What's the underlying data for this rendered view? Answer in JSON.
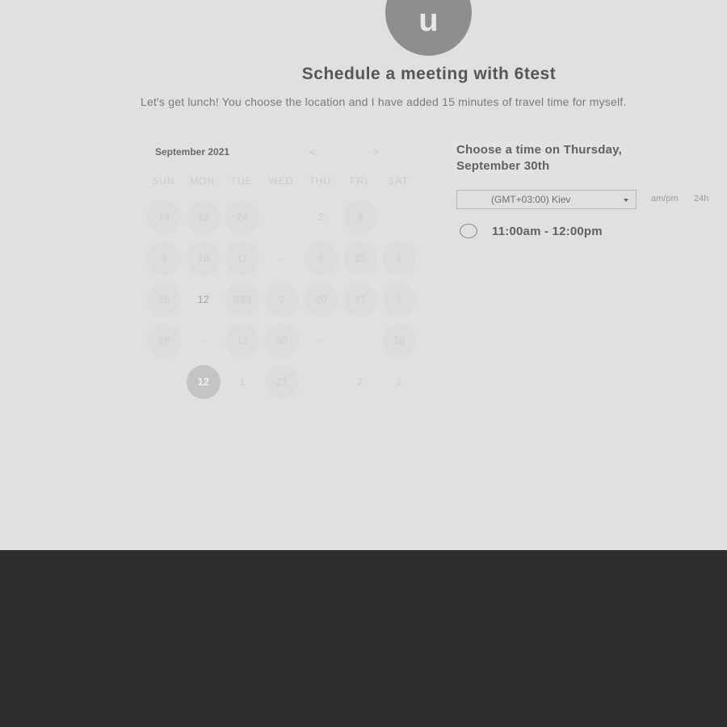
{
  "header": {
    "avatar_letter": "u",
    "title": "Schedule a meeting with 6test",
    "description": "Let's get lunch! You choose the location and I have added 15 minutes of travel time for myself."
  },
  "calendar": {
    "month_label": "September 2021",
    "prev_icon": "<",
    "next_icon": ">",
    "weekdays": [
      "SUN",
      "MON",
      "TUE",
      "WED",
      "THU",
      "FRI",
      "SAT"
    ],
    "weeks": [
      [
        {
          "label": "14",
          "style": "available"
        },
        {
          "label": "18",
          "style": "available"
        },
        {
          "label": "24",
          "style": "available"
        },
        {
          "label": "",
          "style": "plain"
        },
        {
          "label": "2",
          "style": "plain"
        },
        {
          "label": "3",
          "style": "available"
        },
        {
          "label": "",
          "style": "plain"
        }
      ],
      [
        {
          "label": "4",
          "style": "available"
        },
        {
          "label": "18",
          "style": "available"
        },
        {
          "label": "11",
          "style": "available"
        },
        {
          "label": "-",
          "style": "plain"
        },
        {
          "label": "6",
          "style": "available"
        },
        {
          "label": "25",
          "style": "available"
        },
        {
          "label": "1",
          "style": "available"
        }
      ],
      [
        {
          "label": "26",
          "style": "available"
        },
        {
          "label": "12",
          "style": "bright"
        },
        {
          "label": "333",
          "style": "available"
        },
        {
          "label": "2",
          "style": "available"
        },
        {
          "label": "20",
          "style": "available"
        },
        {
          "label": "27",
          "style": "available"
        },
        {
          "label": "7",
          "style": "available"
        }
      ],
      [
        {
          "label": "28",
          "style": "available"
        },
        {
          "label": "-",
          "style": "plain"
        },
        {
          "label": "13",
          "style": "available"
        },
        {
          "label": "30",
          "style": "available"
        },
        {
          "label": "-",
          "style": "plain"
        },
        {
          "label": "",
          "style": "plain"
        },
        {
          "label": "16",
          "style": "available"
        }
      ],
      [
        {
          "label": "",
          "style": "plain"
        },
        {
          "label": "12",
          "style": "selected"
        },
        {
          "label": "1",
          "style": "plain"
        },
        {
          "label": "21",
          "style": "available"
        },
        {
          "label": "",
          "style": "plain"
        },
        {
          "label": "2",
          "style": "plain"
        },
        {
          "label": "1",
          "style": "plain"
        }
      ]
    ]
  },
  "time_picker": {
    "title": "Choose a time on Thursday, September 30th",
    "timezone": "(GMT+03:00) Kiev",
    "format_12h": "am/pm",
    "format_24h": "24h",
    "slots": [
      "11:00am - 12:00pm"
    ]
  },
  "colors": {
    "page_background": "#e0e0e0",
    "bottom_band": "#2e2e2e",
    "avatar": "#8e8e8e"
  }
}
